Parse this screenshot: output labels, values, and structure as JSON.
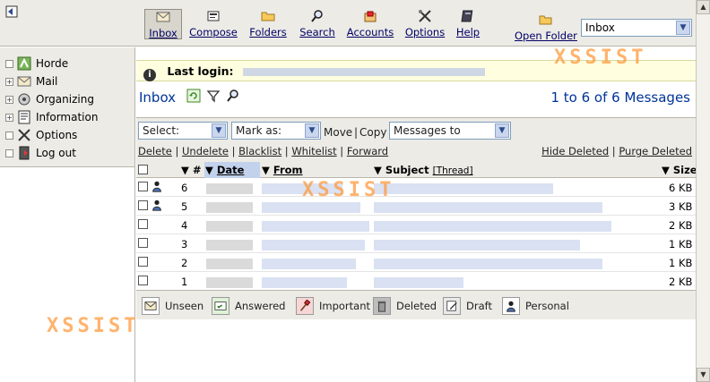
{
  "toolbar": {
    "buttons": [
      {
        "label": "Inbox",
        "icon": "envelope-icon"
      },
      {
        "label": "Compose",
        "icon": "compose-icon"
      },
      {
        "label": "Folders",
        "icon": "folder-icon"
      },
      {
        "label": "Search",
        "icon": "search-icon"
      },
      {
        "label": "Accounts",
        "icon": "accounts-icon"
      },
      {
        "label": "Options",
        "icon": "options-icon"
      },
      {
        "label": "Help",
        "icon": "help-icon"
      }
    ],
    "open_folder_label": "Open Folder",
    "folder_select_value": "Inbox"
  },
  "sidebar": {
    "items": [
      {
        "label": "Horde",
        "icon": "horde-icon"
      },
      {
        "label": "Mail",
        "icon": "mail-icon"
      },
      {
        "label": "Organizing",
        "icon": "organizing-icon"
      },
      {
        "label": "Information",
        "icon": "information-icon"
      },
      {
        "label": "Options",
        "icon": "options-icon"
      },
      {
        "label": "Log out",
        "icon": "logout-icon"
      }
    ]
  },
  "main": {
    "last_login_label": "Last login:",
    "title": "Inbox",
    "message_count": "1 to 6 of 6 Messages",
    "select_value": "Select:",
    "mark_as_value": "Mark as:",
    "move_label": "Move",
    "copy_label": "Copy",
    "messages_to_value": "Messages to",
    "actions_left": {
      "delete": "Delete",
      "undelete": "Undelete",
      "blacklist": "Blacklist",
      "whitelist": "Whitelist",
      "forward": "Forward"
    },
    "actions_right": {
      "hide_deleted": "Hide Deleted",
      "purge_deleted": "Purge Deleted"
    },
    "columns": {
      "num": "#",
      "date": "Date",
      "from": "From",
      "subject": "Subject",
      "thread": "[Thread]",
      "size": "Size"
    },
    "rows": [
      {
        "num": "6",
        "size": "6 KB",
        "personal": true
      },
      {
        "num": "5",
        "size": "3 KB",
        "personal": true
      },
      {
        "num": "4",
        "size": "2 KB",
        "personal": false
      },
      {
        "num": "3",
        "size": "1 KB",
        "personal": false
      },
      {
        "num": "2",
        "size": "1 KB",
        "personal": false
      },
      {
        "num": "1",
        "size": "2 KB",
        "personal": false
      }
    ],
    "legend": [
      {
        "label": "Unseen",
        "icon": "unseen-icon"
      },
      {
        "label": "Answered",
        "icon": "answered-icon"
      },
      {
        "label": "Important",
        "icon": "important-icon"
      },
      {
        "label": "Deleted",
        "icon": "deleted-icon"
      },
      {
        "label": "Draft",
        "icon": "draft-icon"
      },
      {
        "label": "Personal",
        "icon": "personal-icon"
      }
    ]
  },
  "watermark": "XSSIST"
}
